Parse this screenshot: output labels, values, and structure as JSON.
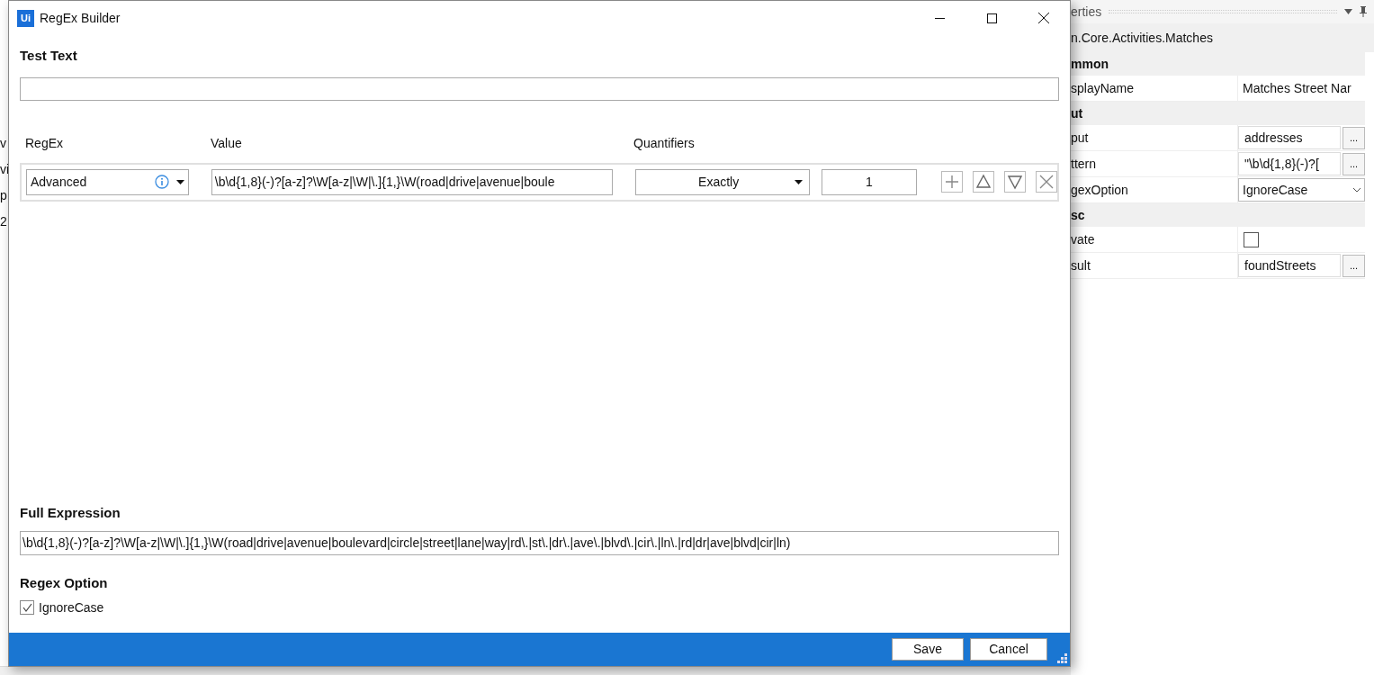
{
  "background": {
    "left_fragments": [
      "v",
      "vi",
      "p",
      "2"
    ],
    "properties": {
      "title": "erties",
      "activity": "n.Core.Activities.Matches",
      "rows": [
        {
          "kind": "category",
          "label": "mmon"
        },
        {
          "kind": "text",
          "label": "splayName",
          "value": "Matches Street Nar"
        },
        {
          "kind": "category",
          "label": "ut"
        },
        {
          "kind": "field",
          "label": "put",
          "value": "addresses",
          "button": "..."
        },
        {
          "kind": "field",
          "label": "ttern",
          "value": "\"\\b\\d{1,8}(-)?[",
          "button": "..."
        },
        {
          "kind": "dropdown",
          "label": "gexOption",
          "value": "IgnoreCase"
        },
        {
          "kind": "category",
          "label": "sc"
        },
        {
          "kind": "checkbox",
          "label": "vate",
          "checked": false
        },
        {
          "kind": "field",
          "label": "sult",
          "value": "foundStreets",
          "button": "..."
        }
      ]
    }
  },
  "window": {
    "logo": "Ui",
    "title": "RegEx Builder"
  },
  "test_text": {
    "label": "Test Text"
  },
  "table": {
    "columns": [
      "RegEx",
      "Value",
      "Quantifiers"
    ],
    "rows": [
      {
        "regex_type": "Advanced",
        "value": "\\b\\d{1,8}(-)?[a-z]?\\W[a-z|\\W|\\.]{1,}\\W(road|drive|avenue|boule",
        "quantifier": "Exactly",
        "count": "1"
      }
    ]
  },
  "full_expression": {
    "label": "Full Expression",
    "value": "\\b\\d{1,8}(-)?[a-z]?\\W[a-z|\\W|\\.]{1,}\\W(road|drive|avenue|boulevard|circle|street|lane|way|rd\\.|st\\.|dr\\.|ave\\.|blvd\\.|cir\\.|ln\\.|rd|dr|ave|blvd|cir|ln)"
  },
  "regex_option": {
    "label": "Regex Option",
    "options": [
      {
        "label": "IgnoreCase",
        "checked": true
      }
    ]
  },
  "buttons": [
    "Save",
    "Cancel"
  ]
}
